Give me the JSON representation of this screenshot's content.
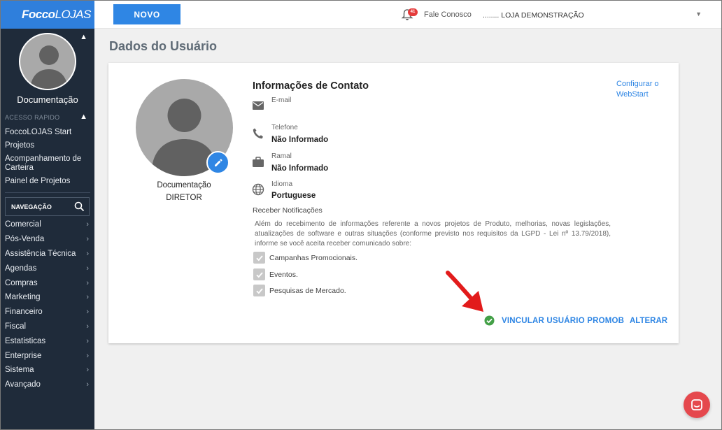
{
  "sidebar": {
    "brand_bold": "Focco",
    "brand_light": "LOJAS",
    "user_name": "Documentação",
    "quick_access_label": "ACESSO RAPIDO",
    "quick_items": [
      "FoccoLOJAS Start",
      "Projetos",
      "Acompanhamento de Carteira",
      "Painel de Projetos"
    ],
    "nav_label": "NAVEGAÇÃO",
    "nav_items": [
      "Comercial",
      "Pós-Venda",
      "Assistência Técnica",
      "Agendas",
      "Compras",
      "Marketing",
      "Financeiro",
      "Fiscal",
      "Estatisticas",
      "Enterprise",
      "Sistema",
      "Avançado"
    ]
  },
  "topbar": {
    "new_button": "NOVO",
    "notification_count": "41",
    "contact_link": "Fale Conosco",
    "store": "........ LOJA DEMONSTRAÇÃO"
  },
  "page": {
    "title": "Dados do Usuário"
  },
  "profile": {
    "name": "Documentação",
    "role": "DIRETOR"
  },
  "contact": {
    "title": "Informações de Contato",
    "config_link": "Configurar o WebStart",
    "email_label": "E-mail",
    "email_value": "",
    "phone_label": "Telefone",
    "phone_value": "Não Informado",
    "ext_label": "Ramal",
    "ext_value": "Não Informado",
    "lang_label": "Idioma",
    "lang_value": "Portuguese"
  },
  "notifications": {
    "title": "Receber Notificações",
    "text": "Além do recebimento de informações referente a novos projetos de Produto, melhorias, novas legislações, atualizações de software e outras situações (conforme previsto nos requisitos da LGPD - Lei nº 13.79/2018), informe se você aceita receber comunicado sobre:",
    "options": [
      {
        "label": "Campanhas Promocionais.",
        "checked": true
      },
      {
        "label": "Eventos.",
        "checked": true
      },
      {
        "label": "Pesquisas de Mercado.",
        "checked": true
      }
    ]
  },
  "actions": {
    "link_user": "VINCULAR USUÁRIO PROMOB",
    "edit": "ALTERAR"
  },
  "colors": {
    "accent": "#2f86e4",
    "sidebar": "#1f2b3a",
    "annotation_arrow": "#e21b1b",
    "success": "#43a047",
    "chat": "#e5484d"
  },
  "icons": [
    "bell-icon",
    "edit-pencil-icon",
    "mail-icon",
    "phone-icon",
    "briefcase-icon",
    "globe-icon",
    "search-icon",
    "check-circle-icon",
    "chat-icon"
  ]
}
